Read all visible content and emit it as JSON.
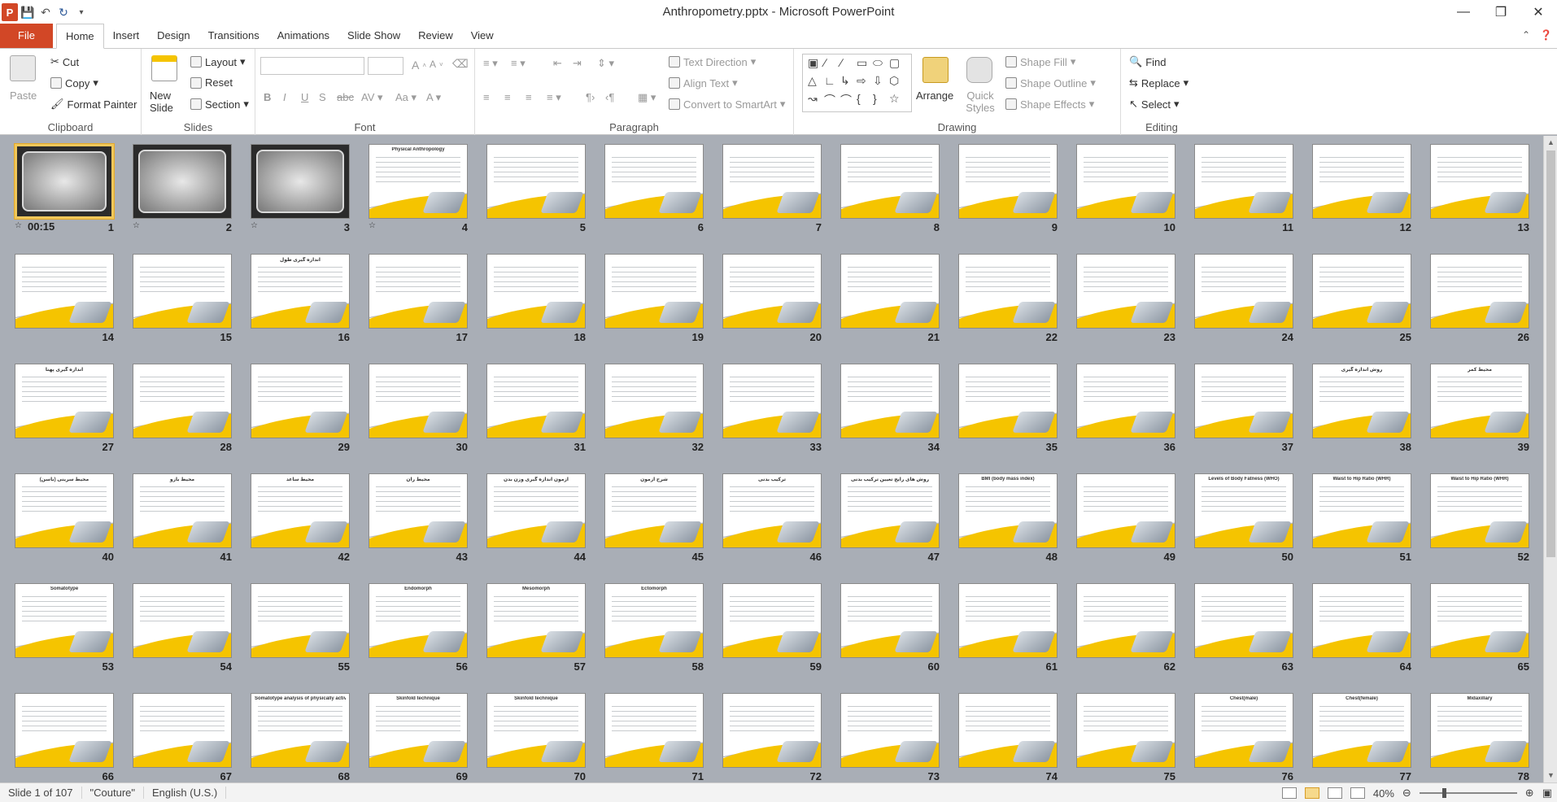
{
  "window": {
    "title": "Anthropometry.pptx - Microsoft PowerPoint",
    "app_initial": "P"
  },
  "tabs": [
    "File",
    "Home",
    "Insert",
    "Design",
    "Transitions",
    "Animations",
    "Slide Show",
    "Review",
    "View"
  ],
  "ribbon": {
    "clipboard": {
      "label": "Clipboard",
      "paste": "Paste",
      "cut": "Cut",
      "copy": "Copy",
      "format_painter": "Format Painter"
    },
    "slides": {
      "label": "Slides",
      "new_slide": "New Slide",
      "layout": "Layout",
      "reset": "Reset",
      "section": "Section"
    },
    "font": {
      "label": "Font"
    },
    "paragraph": {
      "label": "Paragraph",
      "text_direction": "Text Direction",
      "align_text": "Align Text",
      "convert_smartart": "Convert to SmartArt"
    },
    "drawing": {
      "label": "Drawing",
      "arrange": "Arrange",
      "quick_styles": "Quick Styles",
      "shape_fill": "Shape Fill",
      "shape_outline": "Shape Outline",
      "shape_effects": "Shape Effects"
    },
    "editing": {
      "label": "Editing",
      "find": "Find",
      "replace": "Replace",
      "select": "Select"
    }
  },
  "slide_sorter": {
    "selected": 1,
    "first_slide_timing": "00:15",
    "visible_slides": 78,
    "slide_titles": {
      "4": "Physical Anthropology",
      "16": "اندازه گیری طول",
      "27": "اندازه گیری پهنا",
      "38": "روش اندازه گیری",
      "39": "محیط کمر",
      "40": "محیط سرینی (باسن)",
      "41": "محیط بازو",
      "42": "محیط ساعد",
      "43": "محیط ران",
      "44": "آزمون اندازه گیری وزن بدن",
      "45": "شرح آزمون",
      "46": "ترکیب بدنی",
      "47": "روش های رایج تعیین ترکیب بدنی",
      "48": "BMI (body mass index)",
      "50": "Levels of Body Fatness (WHO)",
      "51": "Waist to Hip Ratio (WHR)",
      "52": "Waist to Hip Ratio (WHR)",
      "53": "Somatotype",
      "56": "Endomorph",
      "57": "Mesomorph",
      "58": "Ectomorph",
      "68": "Somatotype analysis of physically active individuals",
      "69": "Skinfold technique",
      "70": "Skinfold technique",
      "76": "Chest(male)",
      "77": "Chest(female)",
      "78": "Midaxillary"
    }
  },
  "status": {
    "slide_of": "Slide 1 of 107",
    "theme": "\"Couture\"",
    "language": "English (U.S.)",
    "zoom": "40%"
  }
}
